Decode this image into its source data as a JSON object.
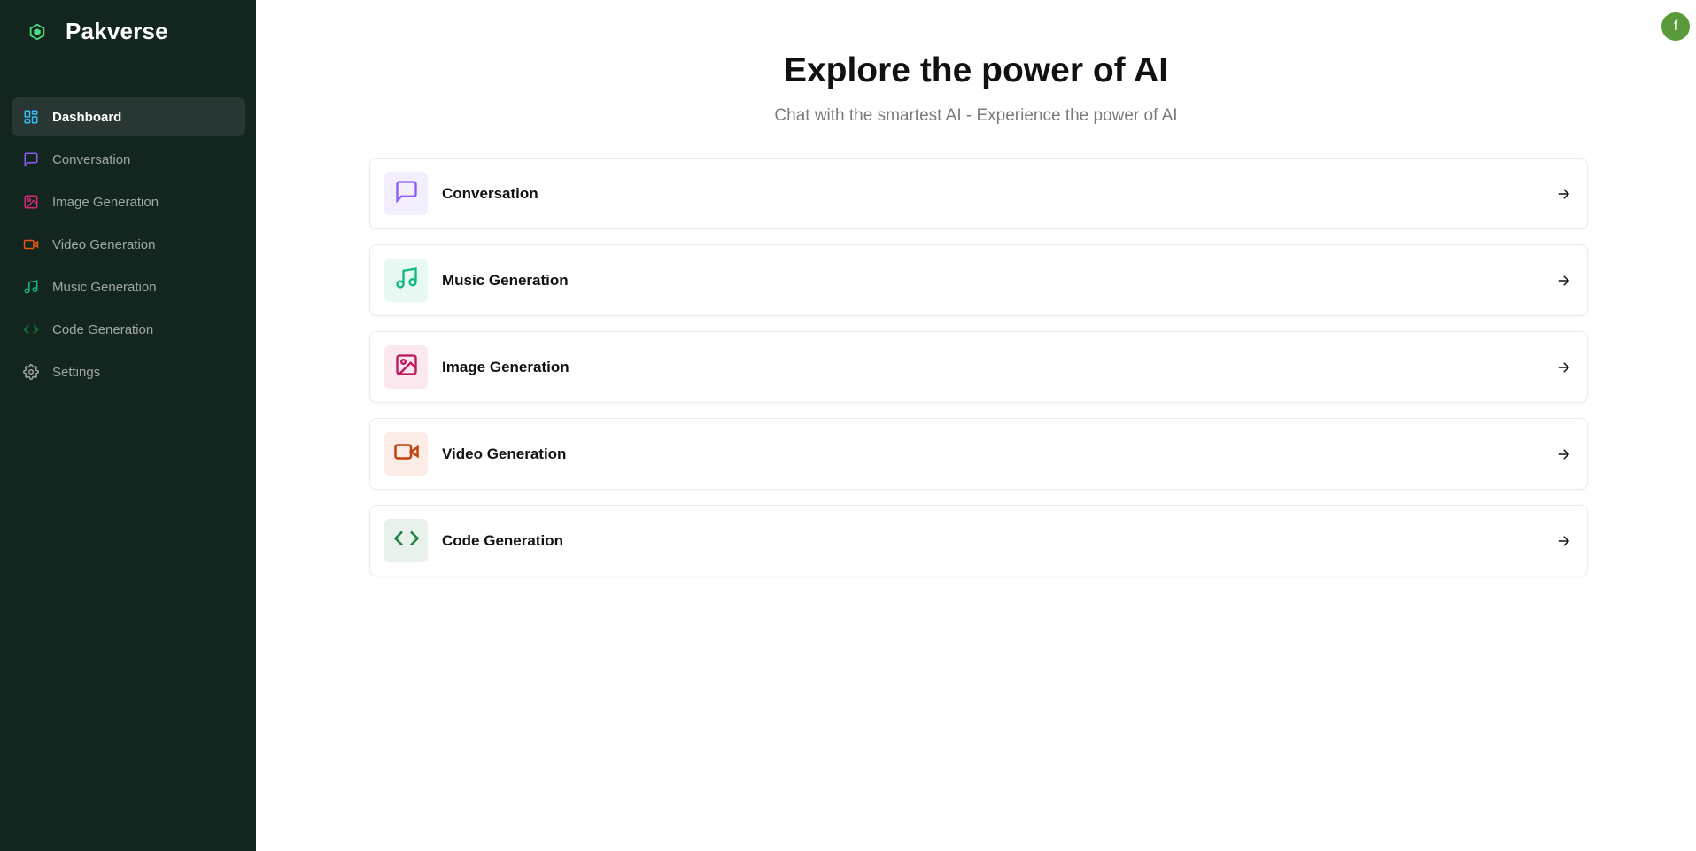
{
  "app": {
    "name": "Pakverse"
  },
  "user": {
    "avatar_initial": "f"
  },
  "sidebar": {
    "items": [
      {
        "label": "Dashboard",
        "icon": "dashboard-icon",
        "color": "#38bdf8",
        "active": true
      },
      {
        "label": "Conversation",
        "icon": "message-icon",
        "color": "#8b5cf6"
      },
      {
        "label": "Image Generation",
        "icon": "image-icon",
        "color": "#db2777"
      },
      {
        "label": "Video Generation",
        "icon": "video-icon",
        "color": "#ea580c"
      },
      {
        "label": "Music Generation",
        "icon": "music-icon",
        "color": "#10b981"
      },
      {
        "label": "Code Generation",
        "icon": "code-icon",
        "color": "#15803d"
      },
      {
        "label": "Settings",
        "icon": "gear-icon",
        "color": "#a1a7a5"
      }
    ]
  },
  "main": {
    "title": "Explore the power of AI",
    "subtitle": "Chat with the smartest AI - Experience the power of AI",
    "cards": [
      {
        "label": "Conversation",
        "icon": "message-icon",
        "color": "#8b5cf6",
        "bg": "#f3effe"
      },
      {
        "label": "Music Generation",
        "icon": "music-icon",
        "color": "#10b981",
        "bg": "#e8f8f2"
      },
      {
        "label": "Image Generation",
        "icon": "image-icon",
        "color": "#be185d",
        "bg": "#fbe9ef"
      },
      {
        "label": "Video Generation",
        "icon": "video-icon",
        "color": "#c2410c",
        "bg": "#fbece5"
      },
      {
        "label": "Code Generation",
        "icon": "code-icon",
        "color": "#15803d",
        "bg": "#e8f2ea"
      }
    ]
  }
}
